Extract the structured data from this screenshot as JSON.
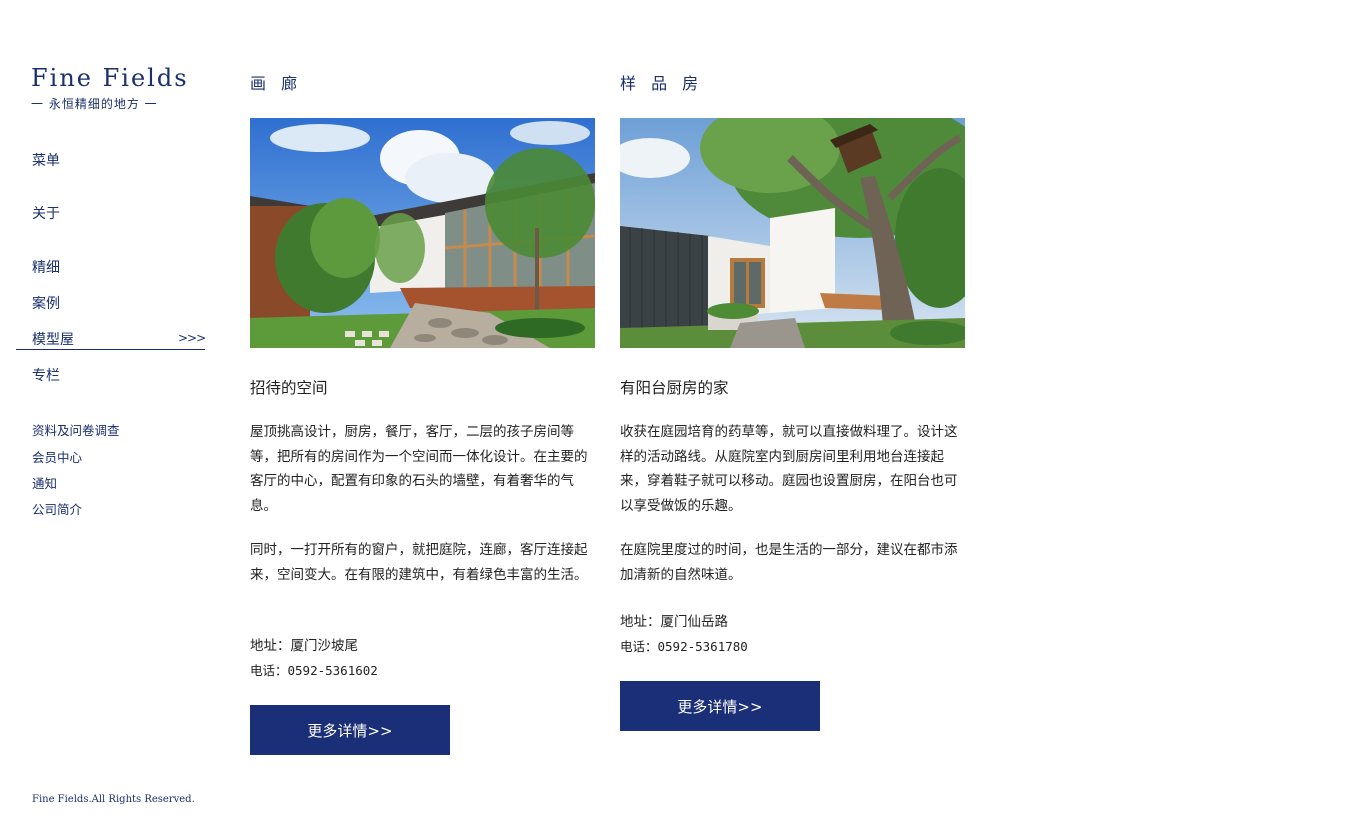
{
  "brand": {
    "name": "Fine Fields",
    "tagline": "一 永恒精细的地方 一"
  },
  "nav": {
    "menu": "菜单",
    "about": "关于",
    "fine": "精细",
    "cases": "案例",
    "model_house": "模型屋",
    "model_house_arrow": ">>>",
    "column": "专栏",
    "survey": "资料及问卷调查",
    "member": "会员中心",
    "notice": "通知",
    "company": "公司简介"
  },
  "footer": "Fine Fields.All Rights Reserved.",
  "gallery": {
    "heading": "画 廊",
    "title": "招待的空间",
    "para1": "屋顶挑高设计，厨房，餐厅，客厅，二层的孩子房间等等，把所有的房间作为一个空间而一体化设计。在主要的客厅的中心，配置有印象的石头的墙壁，有着奢华的气息。",
    "para2": "同时，一打开所有的窗户，就把庭院，连廊，客厅连接起来，空间变大。在有限的建筑中，有着绿色丰富的生活。",
    "address": "地址：厦门沙坡尾",
    "phone": "电话：0592-5361602",
    "button": "更多详情>>"
  },
  "model": {
    "heading": "样 品 房",
    "title": "有阳台厨房的家",
    "para1": "收获在庭园培育的药草等，就可以直接做料理了。设计这样的活动路线。从庭院室内到厨房间里利用地台连接起来，穿着鞋子就可以移动。庭园也设置厨房，在阳台也可以享受做饭的乐趣。",
    "para2": "在庭院里度过的时间，也是生活的一部分，建议在都市添加清新的自然味道。",
    "address": "地址：厦门仙岳路",
    "phone": "电话：0592-5361780",
    "button": "更多详情>>"
  },
  "colors": {
    "brand": "#1a2f6e",
    "button_bg": "#1b2f78"
  }
}
